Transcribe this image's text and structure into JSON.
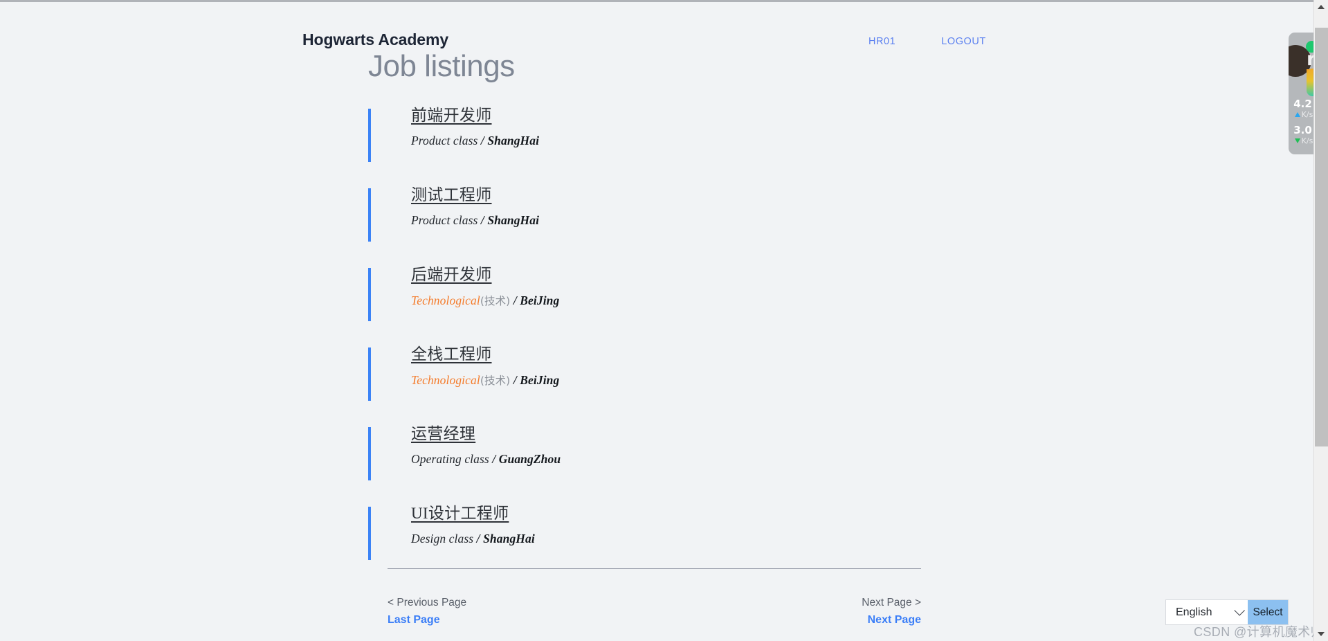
{
  "header": {
    "brand": "Hogwarts Academy",
    "nav": [
      {
        "label": "HR01",
        "name": "nav-link-hr01"
      },
      {
        "label": "LOGOUT",
        "name": "nav-link-logout"
      }
    ]
  },
  "page": {
    "title": "Job listings"
  },
  "jobs": [
    {
      "title": "前端开发师",
      "category_en": "Product class",
      "category_zh": "",
      "separator": "/",
      "city": "ShangHai",
      "accent": false
    },
    {
      "title": "测试工程师",
      "category_en": "Product class",
      "category_zh": "",
      "separator": "/",
      "city": "ShangHai",
      "accent": false
    },
    {
      "title": "后端开发师",
      "category_en": "Technological",
      "category_zh": "(技术)",
      "separator": "/",
      "city": "BeiJing",
      "accent": true
    },
    {
      "title": "全栈工程师",
      "category_en": "Technological",
      "category_zh": "(技术)",
      "separator": "/",
      "city": "BeiJing",
      "accent": true
    },
    {
      "title": "运营经理",
      "category_en": "Operating class",
      "category_zh": "",
      "separator": "/",
      "city": "GuangZhou",
      "accent": false
    },
    {
      "title": "UI设计工程师",
      "category_en": "Design class",
      "category_zh": "",
      "separator": "/",
      "city": "ShangHai",
      "accent": false
    }
  ],
  "pagination": {
    "prev_hint": "< Previous Page",
    "prev_action": "Last Page",
    "next_hint": "Next Page >",
    "next_action": "Next Page"
  },
  "language_bar": {
    "selected": "English",
    "options": [
      "English"
    ],
    "submit_label": "Select"
  },
  "watermark": {
    "text": "CSDN @计算机魔术师"
  },
  "netspeed_widget": {
    "logo_letter": "r",
    "upload_value": "4.2",
    "upload_unit": "K/s",
    "download_value": "3.0",
    "download_unit": "K/s"
  },
  "colors": {
    "background": "#f1f3f5",
    "accent_bar": "#3b82f6",
    "link_blue": "#3b7ef7",
    "nav_blue": "#5c81f0",
    "category_orange": "#f47c2c",
    "title_gray": "#7e8694",
    "select_button": "#8cc0f0"
  }
}
